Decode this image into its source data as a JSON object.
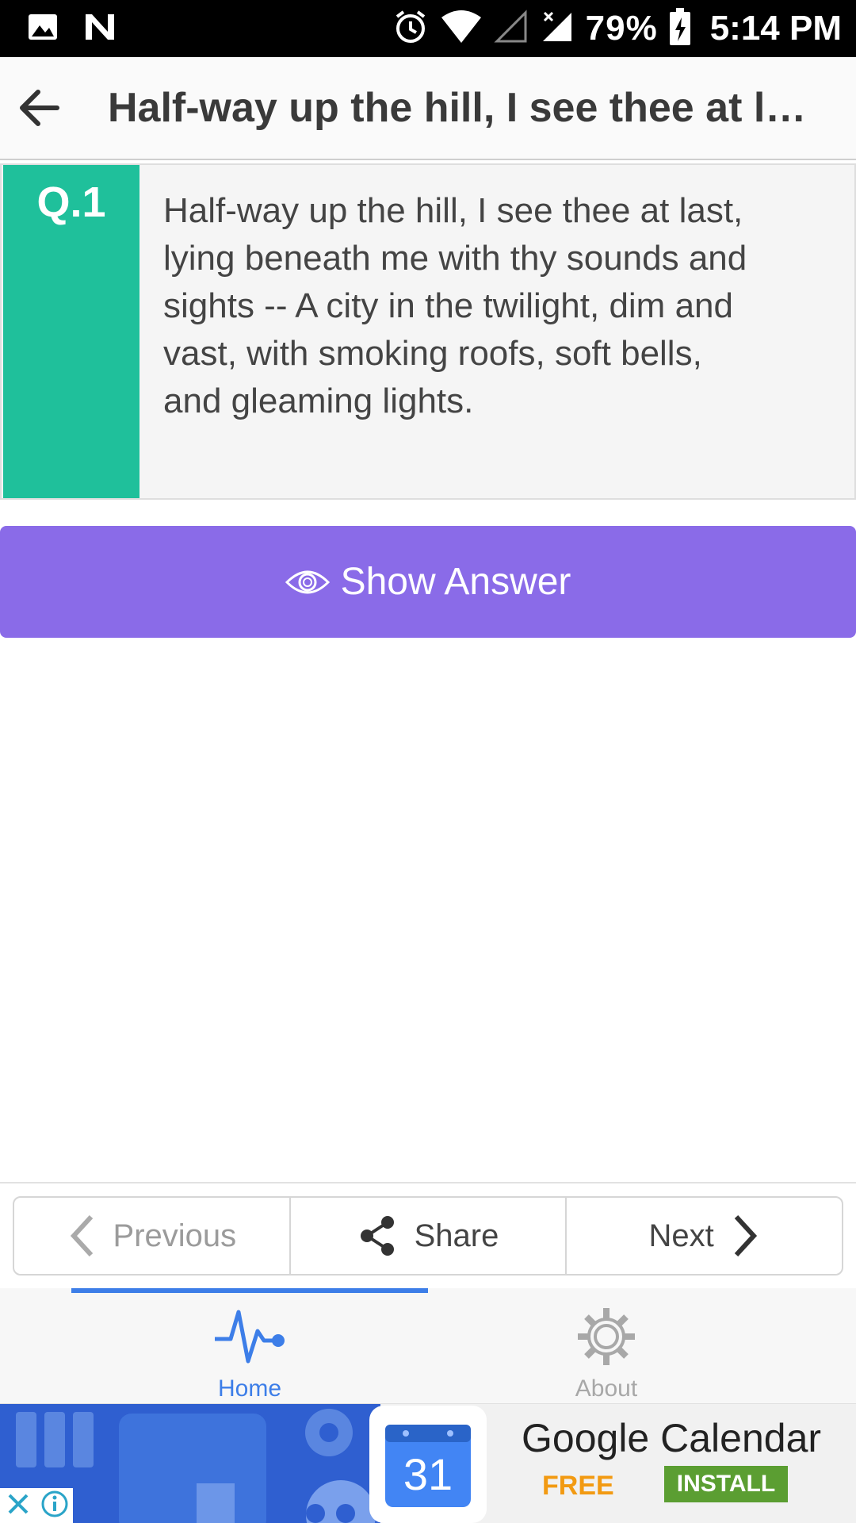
{
  "status_bar": {
    "battery_percent": "79%",
    "time": "5:14 PM"
  },
  "app_bar": {
    "title": "Half-way up the hill, I see thee at l…"
  },
  "question": {
    "number": "Q.1",
    "text": "Half-way up the hill, I see thee at last, lying beneath me with thy sounds and sights -- A city in the twilight, dim and vast, with smoking roofs, soft bells, and gleaming lights."
  },
  "show_answer": {
    "label": "Show Answer"
  },
  "nav": {
    "previous_label": "Previous",
    "share_label": "Share",
    "next_label": "Next"
  },
  "tabs": [
    {
      "label": "Home",
      "active": true
    },
    {
      "label": "About",
      "active": false
    }
  ],
  "ad": {
    "app_name": "Google Calendar",
    "calendar_day": "31",
    "price_label": "FREE",
    "install_label": "INSTALL"
  },
  "colors": {
    "accent_green": "#1fc09b",
    "accent_purple": "#8a6be8",
    "tab_active": "#3d7ee8",
    "ad_install": "#5b9e32",
    "ad_free": "#f29a12"
  }
}
